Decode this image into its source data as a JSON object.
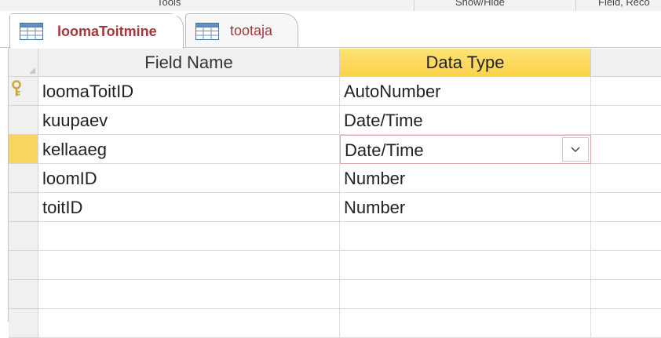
{
  "ribbon": {
    "groups": [
      "Tools",
      "Show/Hide",
      "Field, Reco"
    ]
  },
  "tabs": [
    {
      "label": "loomaToitmine",
      "active": true,
      "icon": "table-icon"
    },
    {
      "label": "tootaja",
      "active": false,
      "icon": "table-icon"
    }
  ],
  "grid": {
    "columns": [
      {
        "label": "Field Name",
        "selected": false
      },
      {
        "label": "Data Type",
        "selected": true
      }
    ],
    "rows": [
      {
        "field_name": "loomaToitID",
        "data_type": "AutoNumber",
        "primary_key": true,
        "current": false
      },
      {
        "field_name": "kuupaev",
        "data_type": "Date/Time",
        "primary_key": false,
        "current": false
      },
      {
        "field_name": "kellaaeg",
        "data_type": "Date/Time",
        "primary_key": false,
        "current": true
      },
      {
        "field_name": "loomID",
        "data_type": "Number",
        "primary_key": false,
        "current": false
      },
      {
        "field_name": "toitID",
        "data_type": "Number",
        "primary_key": false,
        "current": false
      },
      {
        "field_name": "",
        "data_type": "",
        "primary_key": false,
        "current": false
      },
      {
        "field_name": "",
        "data_type": "",
        "primary_key": false,
        "current": false
      },
      {
        "field_name": "",
        "data_type": "",
        "primary_key": false,
        "current": false
      },
      {
        "field_name": "",
        "data_type": "",
        "primary_key": false,
        "current": false
      }
    ]
  },
  "colors": {
    "tab_text": "#a4373a",
    "selected_header": "#fbd24a",
    "current_row_selector": "#f9d45e",
    "key_icon": "#c9a93a"
  }
}
